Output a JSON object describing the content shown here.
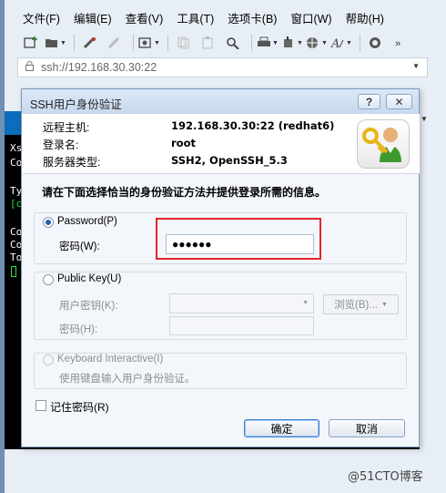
{
  "menubar": {
    "items": [
      "文件(F)",
      "编辑(E)",
      "查看(V)",
      "工具(T)",
      "选项卡(B)",
      "窗口(W)",
      "帮助(H)"
    ]
  },
  "toolbar": {
    "icons": [
      "new-session-icon",
      "open-folder-icon",
      "connect-icon",
      "disconnect-icon",
      "properties-icon",
      "copy-icon",
      "paste-icon",
      "find-icon",
      "print-icon",
      "transfer-icon",
      "globe-icon",
      "font-icon",
      "script-icon",
      "more-icon"
    ]
  },
  "address_bar": {
    "text": "ssh://192.168.30.30:22"
  },
  "terminal": {
    "lines": [
      "Xs",
      "Co",
      "",
      "Ty",
      "[c",
      "",
      "Co",
      "Co",
      "To"
    ]
  },
  "dialog": {
    "title": "SSH用户身份验证",
    "help_label": "?",
    "close_label": "✕",
    "info": {
      "host_label": "远程主机:",
      "host_value": "192.168.30.30:22 (redhat6)",
      "user_label": "登录名:",
      "user_value": "root",
      "server_label": "服务器类型:",
      "server_value": "SSH2, OpenSSH_5.3"
    },
    "instruction": "请在下面选择恰当的身份验证方法并提供登录所需的信息。",
    "password_method": {
      "label": "Password(P)",
      "field_label": "密码(W):",
      "value": "●●●●●●"
    },
    "public_key_method": {
      "label": "Public Key(U)",
      "user_key_label": "用户密钥(K):",
      "browse_label": "浏览(B)...",
      "passphrase_label": "密码(H):"
    },
    "keyboard_method": {
      "label": "Keyboard Interactive(I)",
      "hint": "使用键盘输入用户身份验证。"
    },
    "remember_label": "记住密码(R)",
    "ok_label": "确定",
    "cancel_label": "取消"
  },
  "watermark": "@51CTO博客",
  "colors": {
    "highlight_box": "#e0262b",
    "terminal_bg": "#000000",
    "terminal_green": "#28e03c"
  }
}
